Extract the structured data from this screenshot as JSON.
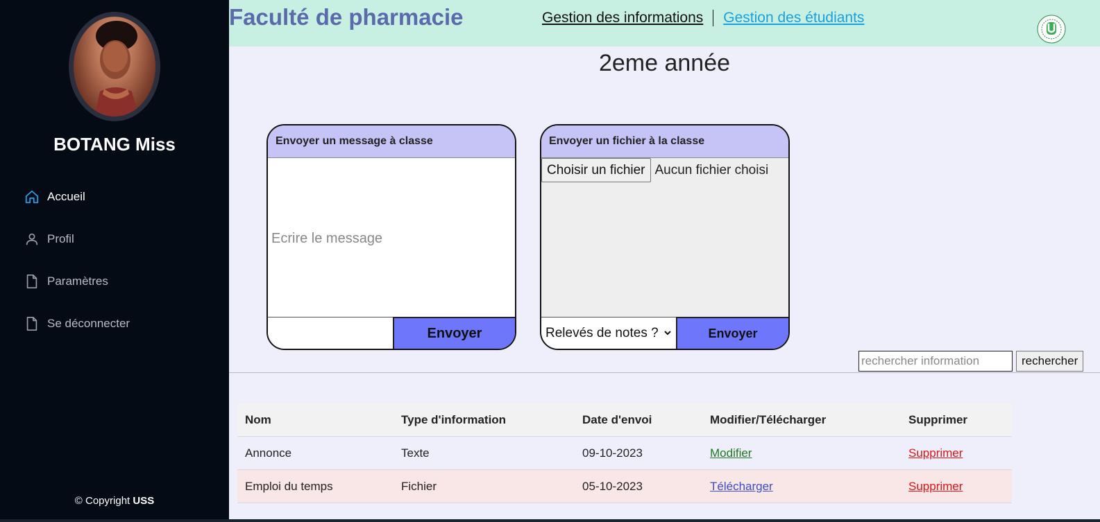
{
  "sidebar": {
    "user_name": "BOTANG Miss",
    "nav": [
      {
        "label": "Accueil",
        "icon": "home-icon",
        "active": true
      },
      {
        "label": "Profil",
        "icon": "user-icon",
        "active": false
      },
      {
        "label": "Paramètres",
        "icon": "document-icon",
        "active": false
      },
      {
        "label": "Se déconnecter",
        "icon": "document-icon",
        "active": false
      }
    ],
    "copyright_prefix": "© Copyright",
    "copyright_brand": "USS"
  },
  "header": {
    "title": "Faculté de pharmacie",
    "links": [
      "Gestion des informations",
      "Gestion des étudiants"
    ],
    "logo": "university-logo"
  },
  "main": {
    "page_title": "2eme année",
    "message_panel": {
      "title": "Envoyer un message à classe",
      "placeholder": "Ecrire le message",
      "send_label": "Envoyer"
    },
    "file_panel": {
      "title": "Envoyer un fichier à la classe",
      "choose_label": "Choisir un fichier",
      "file_status": "Aucun fichier choisi",
      "select_value": "Relevés de notes ?",
      "send_label": "Envoyer"
    },
    "search": {
      "placeholder": "rechercher information",
      "button_label": "rechercher"
    },
    "table": {
      "headers": [
        "Nom",
        "Type d'information",
        "Date d'envoi",
        "Modifier/Télécharger",
        "Supprimer"
      ],
      "rows": [
        {
          "nom": "Annonce",
          "type": "Texte",
          "date": "09-10-2023",
          "action": "Modifier",
          "delete": "Supprimer"
        },
        {
          "nom": "Emploi du temps",
          "type": "Fichier",
          "date": "05-10-2023",
          "action": "Télécharger",
          "delete": "Supprimer"
        }
      ]
    }
  },
  "colors": {
    "sidebar_bg": "#050b14",
    "header_bg": "#c7f0e2",
    "main_bg": "#efeffb",
    "panel_head": "#c6c3f6",
    "send_button": "#6e76fb",
    "title_color": "#5a6aab",
    "link_blue": "#1aa0dc"
  }
}
